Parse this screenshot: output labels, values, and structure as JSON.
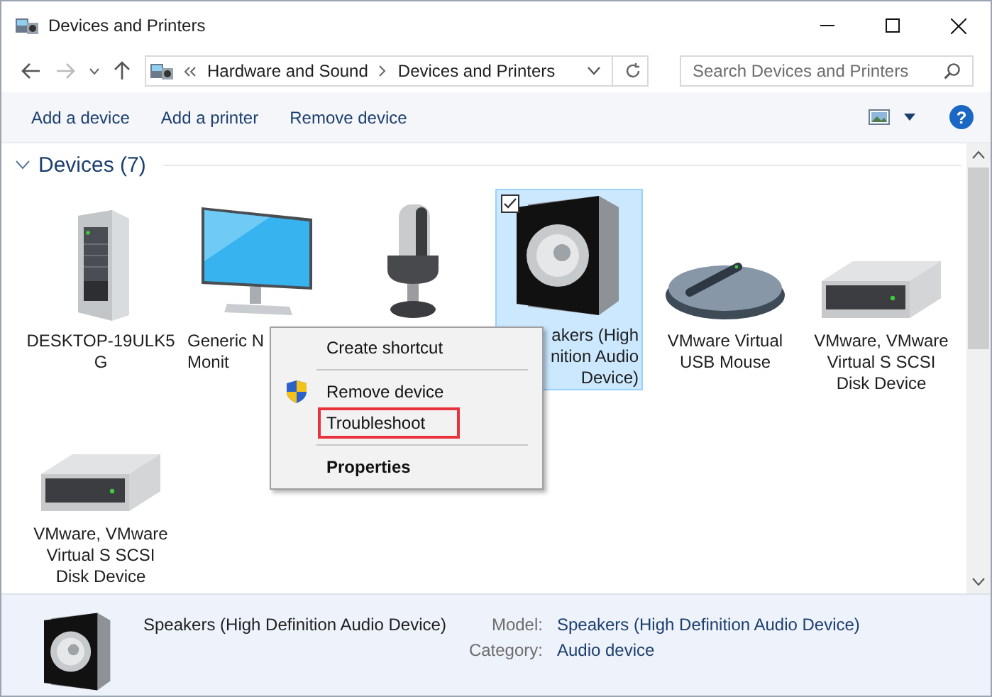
{
  "window": {
    "title": "Devices and Printers"
  },
  "address_bar": {
    "breadcrumbs": [
      "Hardware and Sound",
      "Devices and Printers"
    ]
  },
  "search": {
    "placeholder": "Search Devices and Printers"
  },
  "toolbar": {
    "buttons": [
      "Add a device",
      "Add a printer",
      "Remove device"
    ],
    "help_glyph": "?"
  },
  "section": {
    "title": "Devices (7)",
    "expanded": true
  },
  "devices": [
    {
      "kind": "computer",
      "label_lines": [
        "DESKTOP-19ULK5",
        "G"
      ],
      "selected": false
    },
    {
      "kind": "monitor",
      "label_lines": [
        "Generic N",
        "Monit"
      ],
      "label_cut_right": true,
      "selected": false
    },
    {
      "kind": "microphone",
      "selected": false
    },
    {
      "kind": "speaker",
      "label_lines": [
        "akers (High",
        "nition Audio",
        "Device)"
      ],
      "label_cut_left": true,
      "selected": true
    },
    {
      "kind": "mouse",
      "label_lines": [
        "VMware Virtual",
        "USB Mouse"
      ],
      "selected": false
    },
    {
      "kind": "disk",
      "label_lines": [
        "VMware, VMware",
        "Virtual S SCSI",
        "Disk Device"
      ],
      "selected": false
    },
    {
      "kind": "disk",
      "label_lines": [
        "VMware, VMware",
        "Virtual S SCSI",
        "Disk Device"
      ],
      "selected": false
    }
  ],
  "context_menu": {
    "items": [
      {
        "kind": "item",
        "label": "Create shortcut",
        "shield": false,
        "highlighted": false,
        "bold": false
      },
      {
        "kind": "separator"
      },
      {
        "kind": "item",
        "label": "Remove device",
        "shield": true,
        "highlighted": false,
        "bold": false
      },
      {
        "kind": "item",
        "label": "Troubleshoot",
        "shield": false,
        "highlighted": true,
        "bold": false
      },
      {
        "kind": "separator"
      },
      {
        "kind": "item",
        "label": "Properties",
        "shield": false,
        "highlighted": false,
        "bold": true
      }
    ]
  },
  "details": {
    "name": "Speakers (High Definition Audio Device)",
    "fields": [
      {
        "label": "Model:",
        "value": "Speakers (High Definition Audio Device)"
      },
      {
        "label": "Category:",
        "value": "Audio device"
      }
    ]
  }
}
